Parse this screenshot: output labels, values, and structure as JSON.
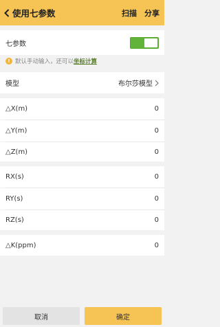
{
  "header": {
    "title": "使用七参数",
    "scan_label": "扫描",
    "share_label": "分享",
    "background": "#f6c455"
  },
  "toggle_row": {
    "label": "七参数",
    "enabled": true,
    "color": "#62b33a"
  },
  "note": {
    "text": "默认手动输入，还可以",
    "link": "坐标计算"
  },
  "model": {
    "label": "模型",
    "value": "布尔莎模型"
  },
  "params": {
    "dx": {
      "label": "△X(m)",
      "value": "0"
    },
    "dy": {
      "label": "△Y(m)",
      "value": "0"
    },
    "dz": {
      "label": "△Z(m)",
      "value": "0"
    },
    "rx": {
      "label": "RX(s)",
      "value": "0"
    },
    "ry": {
      "label": "RY(s)",
      "value": "0"
    },
    "rz": {
      "label": "RZ(s)",
      "value": "0"
    },
    "dk": {
      "label": "△K(ppm)",
      "value": "0"
    }
  },
  "footer": {
    "cancel_label": "取消",
    "ok_label": "确定"
  }
}
